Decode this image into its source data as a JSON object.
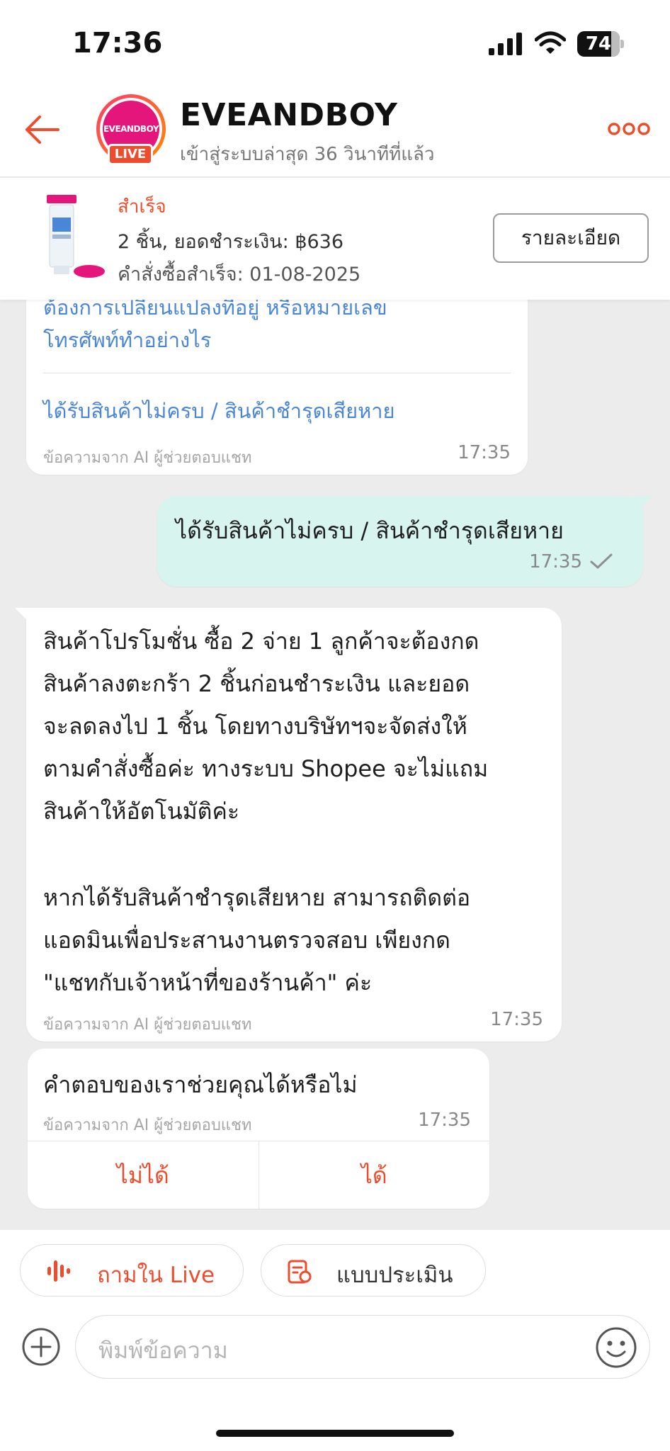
{
  "status_bar": {
    "time": "17:36",
    "battery": "74"
  },
  "header": {
    "shop_name": "EVEANDBOY",
    "last_seen": "เข้าสู่ระบบล่าสุด 36 วินาทีที่แล้ว",
    "avatar_text": "EVEANDBOY",
    "live_badge": "LIVE"
  },
  "order": {
    "status": "สำเร็จ",
    "summary": "2 ชิ้น, ยอดชำระเงิน: ฿636",
    "completed": "คำสั่งซื้อสำเร็จ: 01-08-2025",
    "detail_button": "รายละเอียด"
  },
  "faq_bubble": {
    "question_1_line_a": "ต้องการเปลี่ยนแปลงที่อยู่ หรือหมายเลข",
    "question_1_line_b": "โทรศัพท์ทำอย่างไร",
    "question_2": "ได้รับสินค้าไม่ครบ /  สินค้าชำรุดเสียหาย",
    "meta": "ข้อความจาก AI ผู้ช่วยตอบแชท",
    "time": "17:35"
  },
  "sent_message": {
    "text": "ได้รับสินค้าไม่ครบ /  สินค้าชำรุดเสียหาย",
    "time": "17:35"
  },
  "reply_message": {
    "lines": [
      "สินค้าโปรโมชั่น ซื้อ 2 จ่าย 1  ลูกค้าจะต้องกด",
      "สินค้าลงตะกร้า 2 ชิ้นก่อนชำระเงิน และยอด",
      "จะลดลงไป 1 ชิ้น โดยทางบริษัทฯจะจัดส่งให้",
      "ตามคำสั่งซื้อค่ะ ทางระบบ Shopee จะไม่แถม",
      "สินค้าให้อัตโนมัติค่ะ",
      "หากได้รับสินค้าชำรุดเสียหาย สามารถติดต่อ",
      "แอดมินเพื่อประสานงานตรวจสอบ เพียงกด",
      "\"แชทกับเจ้าหน้าที่ของร้านค้า\" ค่ะ"
    ],
    "meta": "ข้อความจาก AI ผู้ช่วยตอบแชท",
    "time": "17:35"
  },
  "feedback": {
    "question": "คำตอบของเราช่วยคุณได้หรือไม่",
    "meta": "ข้อความจาก AI ผู้ช่วยตอบแชท",
    "time": "17:35",
    "no_label": "ไม่ได้",
    "yes_label": "ได้"
  },
  "quick_actions": {
    "ask_live": "ถามใน Live",
    "evaluation": "แบบประเมิน"
  },
  "composer": {
    "placeholder": "พิมพ์ข้อความ"
  },
  "icons": {
    "back": "arrow-left-icon",
    "more": "more-dots-icon",
    "plus": "plus-circle-icon",
    "emoji": "smiley-icon",
    "sound": "sound-wave-icon",
    "form": "form-icon",
    "check": "check-icon"
  },
  "colors": {
    "accent": "#ee4d2d",
    "link": "#4a86d8",
    "sent_bubble": "#d7f5ee",
    "background": "#ececec"
  }
}
